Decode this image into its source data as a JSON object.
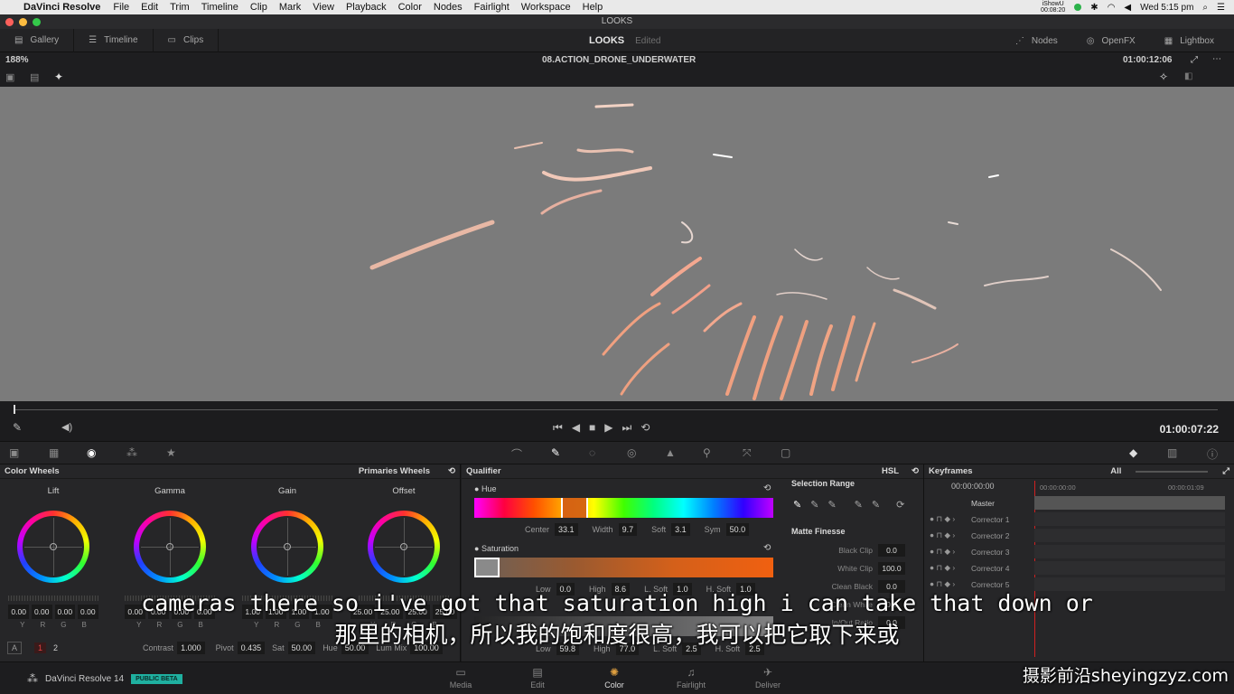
{
  "menubar": {
    "app_name": "DaVinci Resolve",
    "items": [
      "File",
      "Edit",
      "Trim",
      "Timeline",
      "Clip",
      "Mark",
      "View",
      "Playback",
      "Color",
      "Nodes",
      "Fairlight",
      "Workspace",
      "Help"
    ],
    "status_line1": "iShowU",
    "status_line2": "00:08:20",
    "clock": "Wed 5:15 pm"
  },
  "window": {
    "title": "LOOKS"
  },
  "toolbar": {
    "gallery": "Gallery",
    "timeline": "Timeline",
    "clips": "Clips",
    "project": "LOOKS",
    "project_status": "Edited",
    "nodes": "Nodes",
    "openfx": "OpenFX",
    "lightbox": "Lightbox"
  },
  "viewer": {
    "zoom": "188%",
    "clip_name": "08.ACTION_DRONE_UNDERWATER",
    "timecode_top": "01:00:12:06",
    "timecode": "01:00:07:22"
  },
  "color_wheels": {
    "title": "Color Wheels",
    "mode": "Primaries Wheels",
    "wheels": [
      {
        "label": "Lift",
        "values": [
          "0.00",
          "0.00",
          "0.00",
          "0.00"
        ],
        "channels": [
          "Y",
          "R",
          "G",
          "B"
        ]
      },
      {
        "label": "Gamma",
        "values": [
          "0.00",
          "0.00",
          "0.00",
          "0.00"
        ],
        "channels": [
          "Y",
          "R",
          "G",
          "B"
        ]
      },
      {
        "label": "Gain",
        "values": [
          "1.00",
          "1.00",
          "1.00",
          "1.00"
        ],
        "channels": [
          "Y",
          "R",
          "G",
          "B"
        ]
      },
      {
        "label": "Offset",
        "values": [
          "25.00",
          "25.00",
          "25.00",
          "25.00"
        ],
        "channels": [
          "Y",
          "R",
          "G",
          "B"
        ]
      }
    ],
    "page_a": "A",
    "page_1": "1",
    "page_2": "2",
    "contrast_label": "Contrast",
    "contrast": "1.000",
    "pivot_label": "Pivot",
    "pivot": "0.435",
    "sat_label": "Sat",
    "sat": "50.00",
    "hue_label": "Hue",
    "hue": "50.00",
    "lummix_label": "Lum Mix",
    "lummix": "100.00"
  },
  "qualifier": {
    "title": "Qualifier",
    "mode": "HSL",
    "hue": {
      "label": "Hue",
      "center_label": "Center",
      "center": "33.1",
      "width_label": "Width",
      "width": "9.7",
      "soft_label": "Soft",
      "soft": "3.1",
      "sym_label": "Sym",
      "sym": "50.0"
    },
    "saturation": {
      "label": "Saturation",
      "low_label": "Low",
      "low": "0.0",
      "high_label": "High",
      "high": "8.6",
      "lsoft_label": "L. Soft",
      "lsoft": "1.0",
      "hsoft_label": "H. Soft",
      "hsoft": "1.0"
    },
    "luminance": {
      "low": "59.8",
      "high": "77.0",
      "lsoft": "2.5",
      "hsoft": "2.5",
      "low_label": "Low",
      "high_label": "High",
      "lsoft_label": "L. Soft",
      "hsoft_label": "H. Soft"
    }
  },
  "selection_range": {
    "title": "Selection Range",
    "matte_title": "Matte Finesse",
    "black_clip_label": "Black Clip",
    "black_clip": "0.0",
    "white_clip_label": "White Clip",
    "white_clip": "100.0",
    "clean_black_label": "Clean Black",
    "clean_black": "0.0",
    "clean_white_label": "Clean White",
    "clean_white": "0.0",
    "inout_label": "In/Out Ratio",
    "inout": "0.0"
  },
  "keyframes": {
    "title": "Keyframes",
    "filter": "All",
    "tc_left": "00:00:00:00",
    "tc_mid": "00:00:00:00",
    "tc_right": "00:00:01:09",
    "rows": [
      "Master",
      "Corrector 1",
      "Corrector 2",
      "Corrector 3",
      "Corrector 4",
      "Corrector 5"
    ]
  },
  "footer": {
    "product": "DaVinci Resolve 14",
    "badge": "PUBLIC BETA",
    "pages": [
      "Media",
      "Edit",
      "Color",
      "Fairlight",
      "Deliver"
    ]
  },
  "subtitles": {
    "en": "cameras there so i've got that saturation high i can take that down or",
    "zh": "那里的相机，所以我的饱和度很高，我可以把它取下来或",
    "watermark": "摄影前沿sheyingzyz.com"
  }
}
